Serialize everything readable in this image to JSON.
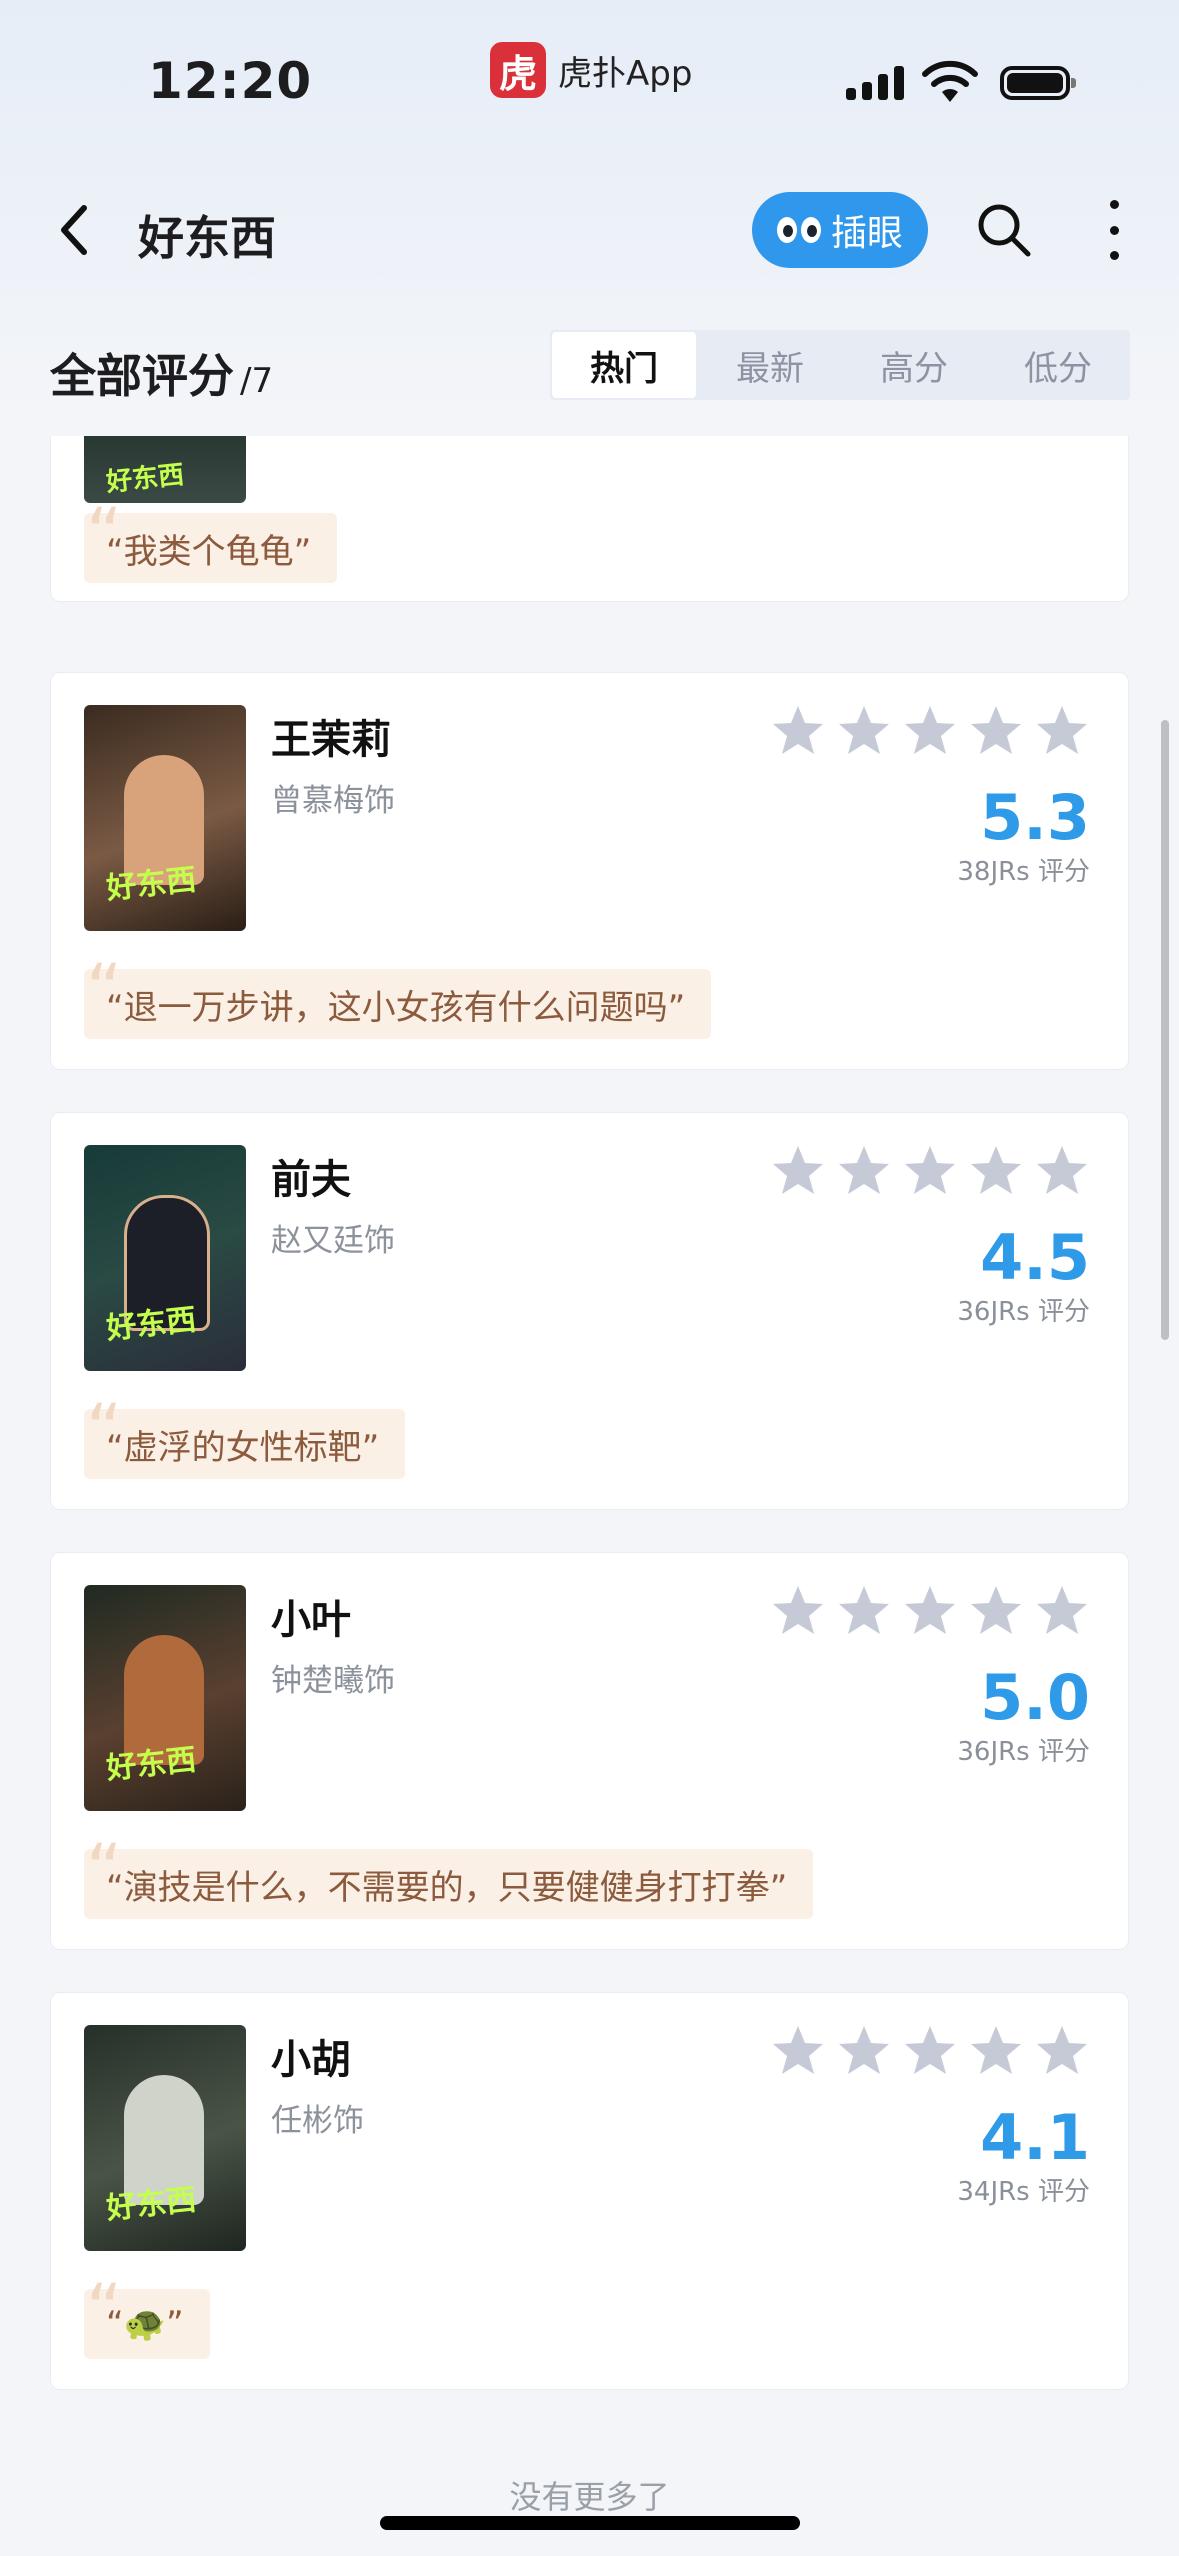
{
  "status_bar": {
    "time": "12:20",
    "app_logo_text": "虎",
    "app_name": "虎扑App",
    "battery": "full"
  },
  "nav": {
    "title": "好东西",
    "chayan_label": "插眼",
    "icons": [
      "back-icon",
      "search-icon",
      "more-icon"
    ]
  },
  "header": {
    "title": "全部评分",
    "count": "/7",
    "tabs": [
      {
        "label": "热门",
        "active": true
      },
      {
        "label": "最新",
        "active": false
      },
      {
        "label": "高分",
        "active": false
      },
      {
        "label": "低分",
        "active": false
      }
    ]
  },
  "partial_card": {
    "poster_title": "好东西",
    "quote": "我类个龟龟"
  },
  "cards": [
    {
      "role": "王茉莉",
      "actor": "曾慕梅饰",
      "score": "5.3",
      "votes": "38JRs 评分",
      "quote": "退一万步讲，这小女孩有什么问题吗",
      "poster_title": "好东西",
      "poster_colors": [
        "#3a2b20",
        "#d8a27a"
      ]
    },
    {
      "role": "前夫",
      "actor": "赵又廷饰",
      "score": "4.5",
      "votes": "36JRs 评分",
      "quote": "虚浮的女性标靶",
      "poster_title": "好东西",
      "poster_colors": [
        "#173b38",
        "#2b2d3a"
      ]
    },
    {
      "role": "小叶",
      "actor": "钟楚曦饰",
      "score": "5.0",
      "votes": "36JRs 评分",
      "quote": "演技是什么，不需要的，只要健健身打打拳",
      "poster_title": "好东西",
      "poster_colors": [
        "#1f2a22",
        "#b06a3c"
      ]
    },
    {
      "role": "小胡",
      "actor": "任彬饰",
      "score": "4.1",
      "votes": "34JRs 评分",
      "quote": "🐢",
      "poster_title": "好东西",
      "poster_colors": [
        "#26302a",
        "#cfd3c9"
      ]
    }
  ],
  "footer": {
    "end_text": "没有更多了"
  },
  "colors": {
    "accent_blue": "#2f97ec",
    "score_blue": "#2f9be8",
    "star_gray": "#c6cad6",
    "quote_bg": "#fbf0e6",
    "quote_text": "#8c5a3c"
  }
}
